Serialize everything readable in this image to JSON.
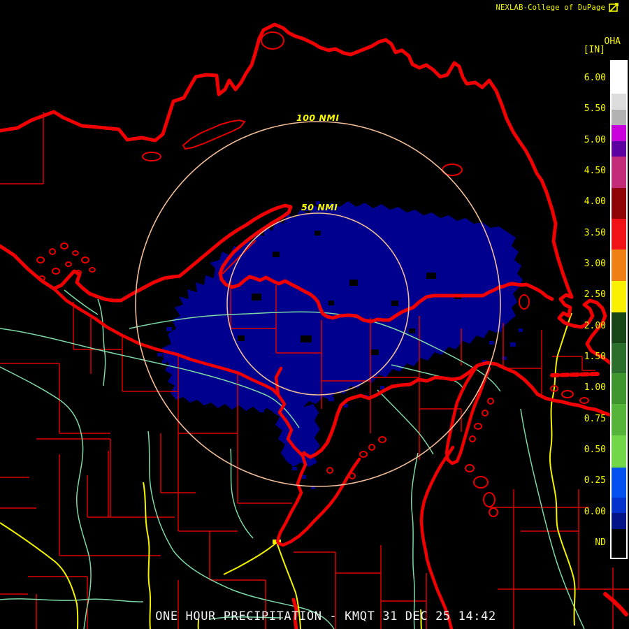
{
  "header": {
    "brand": "NEXLAB-College of DuPage",
    "logo_icon": "flag-icon"
  },
  "product": {
    "code": "OHA",
    "units": "[IN]"
  },
  "colorbar": {
    "labels": [
      "6.00",
      "5.50",
      "5.00",
      "4.50",
      "4.00",
      "3.50",
      "3.00",
      "2.50",
      "2.00",
      "1.50",
      "1.00",
      "0.75",
      "0.50",
      "0.25",
      "0.00",
      "ND"
    ],
    "segments": [
      {
        "color": "#ffffff",
        "h": 46
      },
      {
        "color": "#dcdcdc",
        "h": 23
      },
      {
        "color": "#b2b2b2",
        "h": 22
      },
      {
        "color": "#c800dc",
        "h": 23
      },
      {
        "color": "#5c00a2",
        "h": 22
      },
      {
        "color": "#c22c78",
        "h": 45
      },
      {
        "color": "#8e0406",
        "h": 44
      },
      {
        "color": "#f01216",
        "h": 44
      },
      {
        "color": "#ee8016",
        "h": 45
      },
      {
        "color": "#f8f000",
        "h": 45
      },
      {
        "color": "#174517",
        "h": 44
      },
      {
        "color": "#2c6e2c",
        "h": 43
      },
      {
        "color": "#3f962f",
        "h": 44
      },
      {
        "color": "#55b43a",
        "h": 45
      },
      {
        "color": "#72d84a",
        "h": 46
      },
      {
        "color": "#0350ee",
        "h": 43
      },
      {
        "color": "#0333cc",
        "h": 22
      },
      {
        "color": "#021488",
        "h": 23
      },
      {
        "color": "#000000",
        "h": 41
      }
    ]
  },
  "map": {
    "rings": [
      {
        "label": "100 NMI",
        "radius_nmi": 100
      },
      {
        "label": "50 NMI",
        "radius_nmi": 50
      }
    ],
    "palette": {
      "background": "#000000",
      "boundary_red": "#f00000",
      "county_red": "#dc0000",
      "river_green": "#7cd8a4",
      "highway_yellow": "#f2f200",
      "ring_salmon": "#f0bc96",
      "precip_navy": "#00008e",
      "text_yellow": "#f8f800",
      "text_white": "#f2f2f2"
    }
  },
  "footer": {
    "caption": "ONE HOUR PRECIPITATION - KMQT 31 DEC 25 14:42"
  }
}
